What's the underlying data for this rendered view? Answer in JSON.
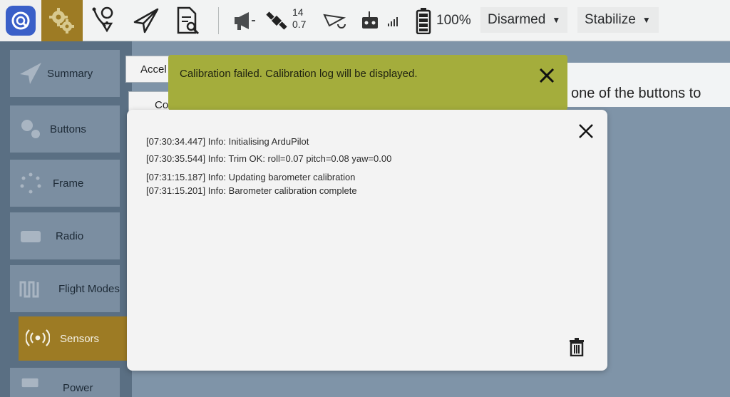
{
  "toolbar": {
    "icons": [
      "app-logo-icon",
      "settings-gear-icon",
      "plan-waypoint-icon",
      "fly-paper-plane-icon",
      "analyze-document-icon",
      "megaphone-icon",
      "gps-satellite-icon",
      "telemetry-plane-icon",
      "rc-transmitter-icon",
      "battery-icon"
    ],
    "gps_count": "14",
    "gps_hdop": "0.7",
    "battery_percent": "100%",
    "arm_state": "Disarmed",
    "flight_mode": "Stabilize"
  },
  "sidebar": {
    "items": [
      {
        "label": "Summary",
        "icon": "paper-plane-icon"
      },
      {
        "label": "Buttons",
        "icon": "gears-icon"
      },
      {
        "label": "Frame",
        "icon": "frame-dots-icon"
      },
      {
        "label": "Radio",
        "icon": "radio-icon"
      },
      {
        "label": "Flight Modes",
        "icon": "waveform-icon"
      },
      {
        "label": "Sensors",
        "icon": "sensors-broadcast-icon",
        "active": true
      },
      {
        "label": "Power",
        "icon": "power-icon"
      }
    ]
  },
  "sensors": {
    "accel_label": "Accel",
    "compass_label": "Co",
    "instruction_text": "one of the buttons to"
  },
  "toast": {
    "message": "Calibration failed. Calibration log will be displayed."
  },
  "log": {
    "lines": [
      "[07:30:34.447] Info: Initialising ArduPilot",
      "[07:30:35.544] Info: Trim OK: roll=0.07 pitch=0.08 yaw=0.00",
      "[07:31:15.187] Info: Updating barometer calibration",
      "[07:31:15.201] Info: Barometer calibration complete"
    ]
  },
  "colors": {
    "active_accent": "#9d7b24",
    "toast_background": "#a4ad3c",
    "sidebar_background": "#5a6f83",
    "toolbar_background": "#f2f3f3"
  }
}
